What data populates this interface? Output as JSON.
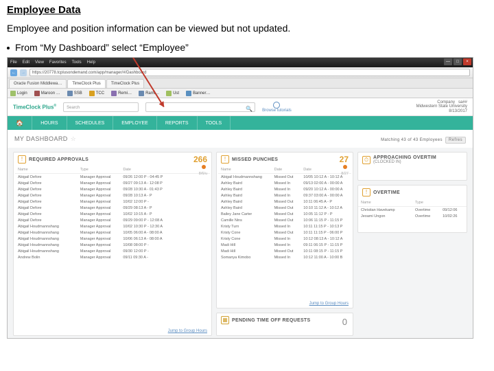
{
  "header": {
    "title": "Employee Data",
    "subtitle": "Employee and position information can be viewed but not updated.",
    "bullet": "From “My Dashboard” select “Employee”"
  },
  "browser": {
    "menu": [
      "File",
      "Edit",
      "View",
      "Favorites",
      "Tools",
      "Help"
    ],
    "url": "https://20778.tcplusondemand.com/app/manager/#/Dashboard",
    "tabs": [
      "Oracle Fusion Middlewa…",
      "TimeClock Plus",
      "TimeClock Plus"
    ],
    "bookmarks": [
      "Login",
      "Maroon …",
      "SSB",
      "TCC",
      "Remi…",
      "Rami…",
      "Ust",
      "Banner…"
    ]
  },
  "app": {
    "logo": "TimeClock Plus",
    "search_placeholder": "Search",
    "browse_tutorials": "Browse tutorials",
    "company": "Company",
    "company_name": "Midwestern State University",
    "user": "sa##",
    "date": "8/13/2017"
  },
  "nav": [
    "HOURS",
    "SCHEDULES",
    "EMPLOYEE",
    "REPORTS",
    "TOOLS"
  ],
  "dashboard": {
    "title": "MY DASHBOARD",
    "matching": "Matching 43 of 43 Employees",
    "refresh": "Refres"
  },
  "approvals": {
    "title": "REQUIRED APPROVALS",
    "count": "266",
    "date": "8/6/u",
    "headers": [
      "Name",
      "Type",
      "Date"
    ],
    "rows": [
      [
        "Abigail Defore",
        "Manager Approval",
        "09/26 12:00 P - 04:45 P"
      ],
      [
        "Abigail Defore",
        "Manager Approval",
        "09/27 09:13 A - 12:08 P"
      ],
      [
        "Abigail Defore",
        "Manager Approval",
        "09/28 10:30 A - 01:43 P"
      ],
      [
        "Abigail Defore",
        "Manager Approval",
        "09/28 10:13 A - P"
      ],
      [
        "Abigail Defore",
        "Manager Approval",
        "10/02 12:00 P -"
      ],
      [
        "Abigail Defore",
        "Manager Approval",
        "09/29 08:13 A - P"
      ],
      [
        "Abigail Defore",
        "Manager Approval",
        "10/02 10:15 A - P"
      ],
      [
        "Abigail Defore",
        "Manager Approval",
        "09/29 09:00 P - 12:08 A"
      ],
      [
        "Abigail Houdmannshang",
        "Manager Approval",
        "10/02 10:30 P - 12:30 A"
      ],
      [
        "Abigail Houdmannshang",
        "Manager Approval",
        "10/05 06:00 A - 08:00 A"
      ],
      [
        "Abigail Houdmannshang",
        "Manager Approval",
        "10/06 06:13 A - 08:00 A"
      ],
      [
        "Abigail Houdmannshang",
        "Manager Approval",
        "10/08 08:00 P -"
      ],
      [
        "Abigail Houdmannshang",
        "Manager Approval",
        "09/30 12:00 P -"
      ],
      [
        "Andrew Bolin",
        "Manager Approval",
        "09/11 09:30 A -"
      ]
    ],
    "jump": "Jump to Group Hours"
  },
  "missed": {
    "title": "MISSED PUNCHES",
    "count": "27",
    "date": "8/27",
    "headers": [
      "Name",
      "Date",
      "Date"
    ],
    "rows": [
      [
        "Abigail Houdmannshang",
        "Missed Out",
        "10/05 10:12 A - 10:12 A"
      ],
      [
        "Ashley Baird",
        "Missed In",
        "09/13 02:00 A - 00:00 A"
      ],
      [
        "Ashley Baird",
        "Missed In",
        "09/20 10:12 A - 00:00 A"
      ],
      [
        "Ashley Baird",
        "Missed In",
        "09:37 03:00 A - 00:00 A"
      ],
      [
        "Ashley Baird",
        "Missed Out",
        "10:11 06:45 A - P"
      ],
      [
        "Ashley Baird",
        "Missed Out",
        "10:10 11:12 A - 10:12 A"
      ],
      [
        "Bailey Jane Carter",
        "Missed Out",
        "10:05 11:12 P - P"
      ],
      [
        "Camille Nins",
        "Missed Out",
        "10:06 11:15 P - 11:15 P"
      ],
      [
        "Kristy Turn",
        "Missed In",
        "10:11 11:15 P - 10:13 P"
      ],
      [
        "Kristy Cone",
        "Missed Out",
        "10:11 11:15 P - 06:00 P"
      ],
      [
        "Kristy Cone",
        "Missed In",
        "10:12 08:13 A - 10:12 A"
      ],
      [
        "Madi Hill",
        "Missed In",
        "09:11 06:15 P - 11:15 P"
      ],
      [
        "Madi Hill",
        "Missed Out",
        "10:11 08:15 P - 11:15 P"
      ],
      [
        "Somanya Kimobo",
        "Missed In",
        "10:12 11:00 A - 10:00 B"
      ]
    ],
    "jump": "Jump to Group Hours"
  },
  "approaching": {
    "title": "APPROACHING OVERTIM",
    "subtitle": "(CLOCKED IN)"
  },
  "overtime": {
    "title": "OVERTIME",
    "headers": [
      "Name",
      "Type",
      ""
    ],
    "rows": [
      [
        "Christian Havekamp",
        "Overtime",
        "09/12:06"
      ],
      [
        "Jeoami Ungon",
        "Overtime",
        "10/02:26"
      ]
    ]
  },
  "pending": {
    "title": "PENDING TIME OFF REQUESTS",
    "count": "0"
  }
}
